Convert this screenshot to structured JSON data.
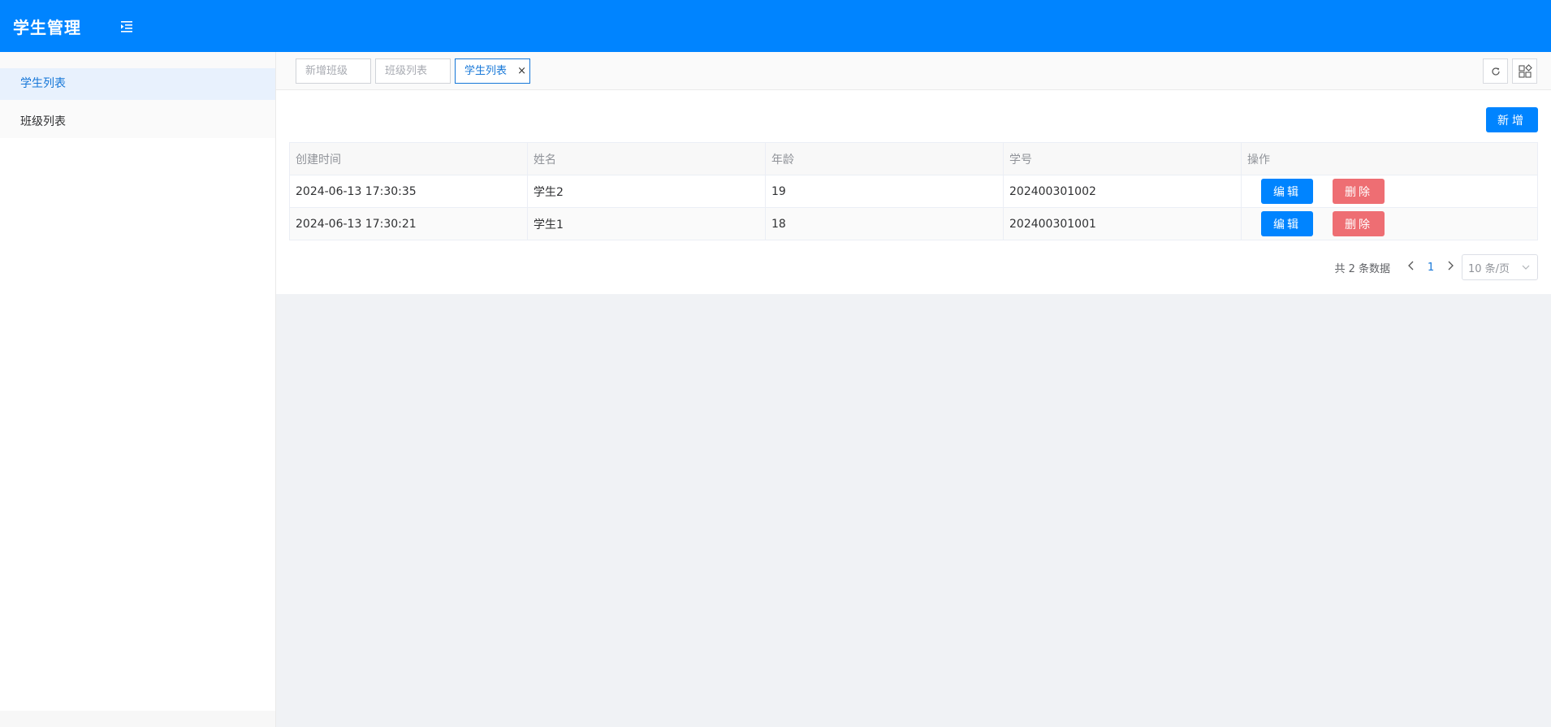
{
  "header": {
    "title": "学生管理"
  },
  "sidebar": {
    "items": [
      {
        "label": "学生列表",
        "active": true
      },
      {
        "label": "班级列表",
        "active": false
      }
    ]
  },
  "tabs": [
    {
      "label": "新增班级",
      "active": false
    },
    {
      "label": "班级列表",
      "active": false
    },
    {
      "label": "学生列表",
      "active": true,
      "close": "×"
    }
  ],
  "toolbar": {
    "refresh_icon": "refresh-icon",
    "layout_icon": "grid-layout-icon"
  },
  "content": {
    "add_label": "新增",
    "table": {
      "headers": [
        "创建时间",
        "姓名",
        "年龄",
        "学号",
        "操作"
      ],
      "rows": [
        {
          "created": "2024-06-13 17:30:35",
          "name": "学生2",
          "age": "19",
          "sid": "202400301002"
        },
        {
          "created": "2024-06-13 17:30:21",
          "name": "学生1",
          "age": "18",
          "sid": "202400301001"
        }
      ],
      "edit_label": "编辑",
      "delete_label": "删除"
    },
    "pagination": {
      "total_text": "共 2 条数据",
      "current_page": "1",
      "page_size": "10 条/页"
    }
  },
  "colors": {
    "primary": "#0084ff",
    "danger": "#ee6e73",
    "active_text": "#1677d8"
  }
}
